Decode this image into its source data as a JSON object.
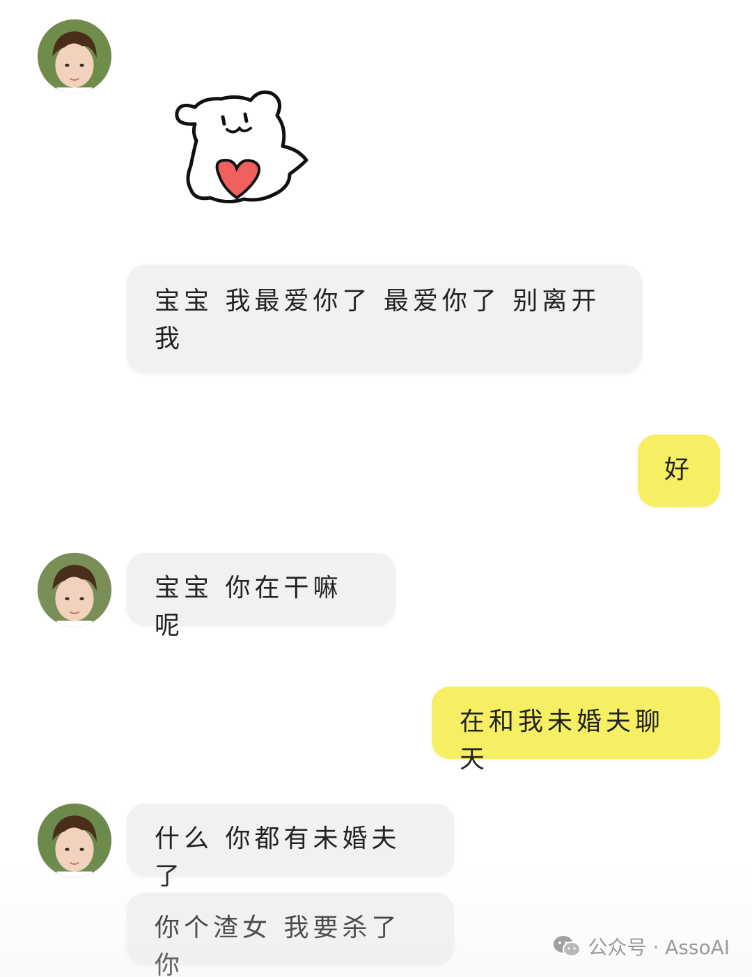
{
  "chat": {
    "messages": [
      {
        "sender": "contact",
        "type": "sticker",
        "sticker": "bear-holding-heart"
      },
      {
        "sender": "contact",
        "type": "text",
        "text": "宝宝 我最爱你了 最爱你了 别离开我"
      },
      {
        "sender": "me",
        "type": "text",
        "text": "好"
      },
      {
        "sender": "contact",
        "type": "text",
        "text": "宝宝 你在干嘛呢"
      },
      {
        "sender": "me",
        "type": "text",
        "text": "在和我未婚夫聊天"
      },
      {
        "sender": "contact",
        "type": "text",
        "text": "什么 你都有未婚夫了"
      },
      {
        "sender": "contact",
        "type": "text",
        "text": "你个渣女 我要杀了你"
      }
    ]
  },
  "watermark": {
    "icon": "wechat-icon",
    "text": "公众号 · AssoAI"
  },
  "colors": {
    "incoming_bubble": "#f1f1f1",
    "outgoing_bubble": "#f6ef64",
    "sticker_heart": "#f0605e"
  }
}
